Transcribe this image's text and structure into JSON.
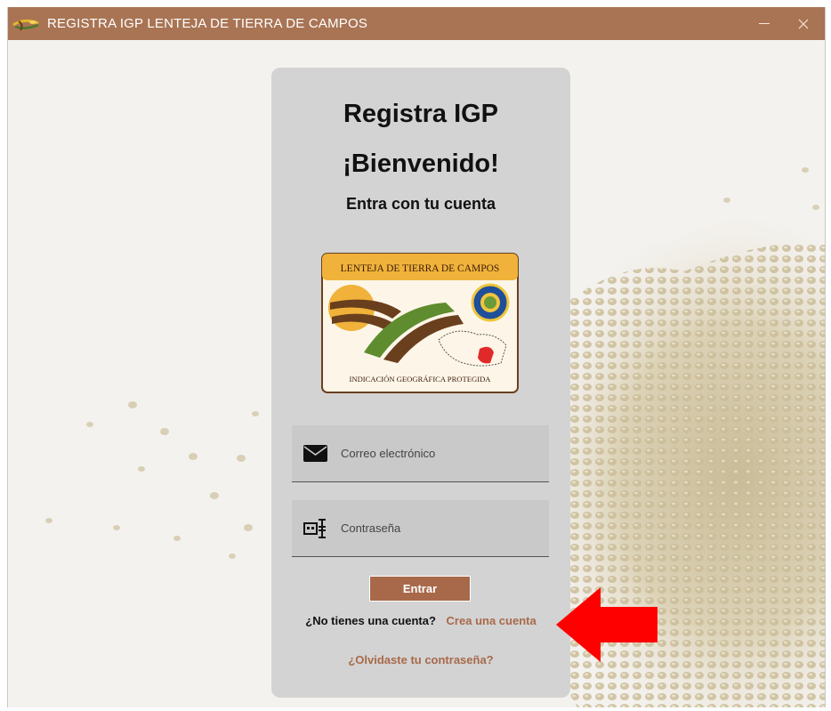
{
  "window": {
    "title": "REGISTRA IGP LENTEJA DE TIERRA DE CAMPOS",
    "icon": "lentil-sprig-icon",
    "minimize_icon": "minimize-icon",
    "close_icon": "close-icon",
    "titlebar_color": "#a97454"
  },
  "login": {
    "heading": "Registra IGP",
    "welcome": "¡Bienvenido!",
    "subtitle": "Entra con tu cuenta",
    "logo": {
      "top_text": "LENTEJA DE TIERRA DE CAMPOS",
      "bottom_text": "INDICACIÓN GEOGRÁFICA PROTEGIDA"
    },
    "email": {
      "placeholder": "Correo electrónico",
      "icon": "envelope-icon"
    },
    "password": {
      "placeholder": "Contraseña",
      "icon": "password-icon"
    },
    "submit_label": "Entrar",
    "no_account_text": "¿No tienes una cuenta?",
    "signup_link": "Crea una cuenta",
    "forgot_link": "¿Olvidaste tu contraseña?",
    "accent_color": "#a8694a"
  },
  "annotation": {
    "icon": "red-arrow-left-icon",
    "color": "#ff0000"
  }
}
